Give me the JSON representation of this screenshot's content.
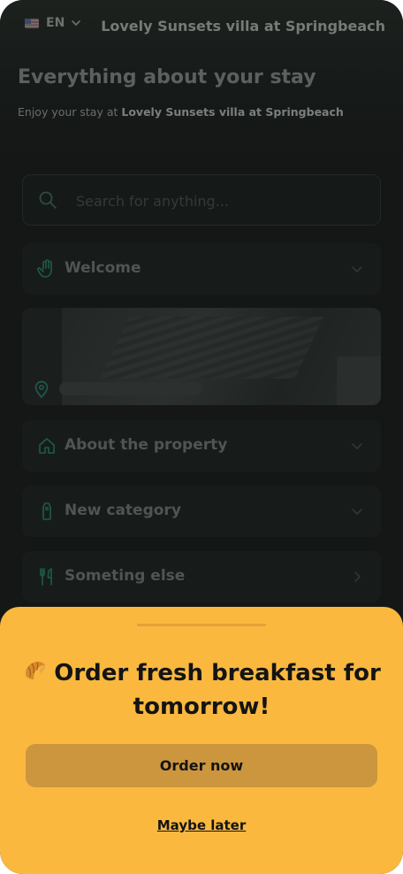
{
  "header": {
    "language": "EN",
    "property_name": "Lovely Sunsets villa at Springbeach"
  },
  "intro": {
    "title": "Everything about your stay",
    "subtitle_prefix": "Enjoy your stay at ",
    "subtitle_property": "Lovely Sunsets villa at Springbeach"
  },
  "search": {
    "placeholder": "Search for anything...",
    "value": ""
  },
  "categories": [
    {
      "label": "Welcome",
      "icon": "hand-icon"
    },
    {
      "label": "About the property",
      "icon": "house-icon"
    },
    {
      "label": "New category",
      "icon": "tag-icon"
    },
    {
      "label": "Someting else",
      "icon": "utensils-icon"
    }
  ],
  "promo": {
    "emoji": "croissant-icon",
    "title": "Order fresh breakfast for tomorrow!",
    "primary_label": "Order now",
    "secondary_label": "Maybe later"
  },
  "colors": {
    "sheet": "#fab83f",
    "primary_button": "#cc963f",
    "background": "#141716",
    "accent_icon": "#1f5a4d"
  }
}
